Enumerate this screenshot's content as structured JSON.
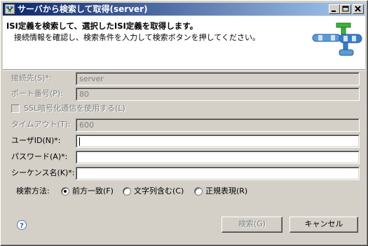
{
  "window": {
    "title": "サーバから検索して取得(server)"
  },
  "header": {
    "title": "ISI定義を検索して、選択したISI定義を取得します。",
    "description": "接続情報を確認し、検索条件を入力して検索ボタンを押してください。"
  },
  "form": {
    "connection": {
      "label": "接続先(S)*:",
      "value": "server"
    },
    "port": {
      "label": "ポート番号(P):",
      "value": "80"
    },
    "ssl": {
      "label": "SSL暗号化通信を使用する(L)",
      "checked": false
    },
    "timeout": {
      "label": "タイムアウト(T):",
      "value": "600"
    },
    "user_id": {
      "label": "ユーザID(N)*:",
      "value": ""
    },
    "password": {
      "label": "パスワード(A)*:",
      "value": ""
    },
    "sequence_name": {
      "label": "シーケンス名(K)*:",
      "value": ""
    }
  },
  "search_method": {
    "label": "検索方法:",
    "options": [
      {
        "label": "前方一致(F)",
        "selected": true
      },
      {
        "label": "文字列含む(C)",
        "selected": false
      },
      {
        "label": "正規表現(R)",
        "selected": false
      }
    ]
  },
  "buttons": {
    "search": "検索(G)",
    "cancel": "キャンセル"
  },
  "icons": {
    "title": "app-icon",
    "help": "help-icon",
    "header_graphic": "flow-diagram-icon"
  },
  "colors": {
    "titlebar_start": "#0a246a",
    "titlebar_end": "#a6caf0",
    "dialog_bg": "#d4d0c8",
    "graphic_blue": "#3a7cc8",
    "graphic_green": "#3db03d"
  }
}
